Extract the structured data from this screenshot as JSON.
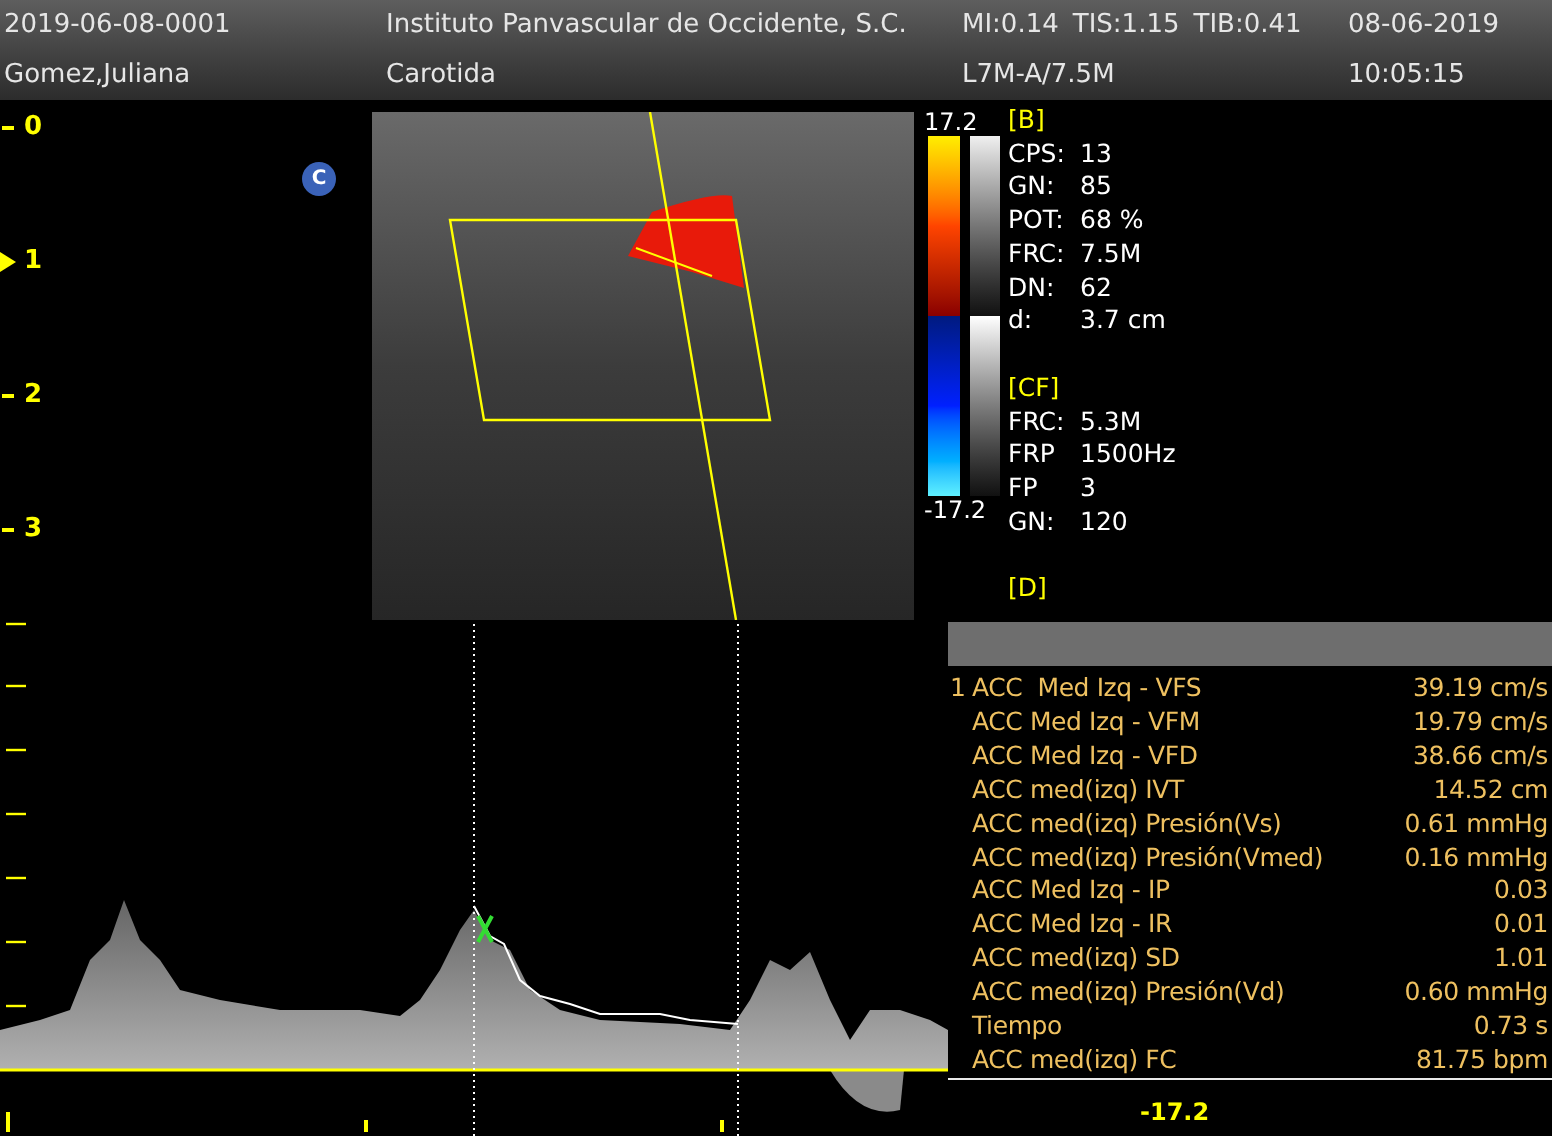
{
  "header": {
    "study_id": "2019-06-08-0001",
    "institution": "Instituto Panvascular de Occidente, S.C.",
    "indices": [
      "MI:0.14",
      "TIS:1.15",
      "TIB:0.41"
    ],
    "date": "08-06-2019",
    "patient": "Gomez,Juliana",
    "exam": "Carotida",
    "probe": "L7M-A/7.5M",
    "time": "10:05:15"
  },
  "depth_scale": [
    {
      "label": "0",
      "focus": false
    },
    {
      "label": "1",
      "focus": true
    },
    {
      "label": "2",
      "focus": false
    },
    {
      "label": "3",
      "focus": false
    }
  ],
  "mode_badge": "C",
  "color_scale": {
    "max": "17.2",
    "min": "-17.2"
  },
  "parameters": [
    {
      "heading": "[B]",
      "rows": [
        {
          "label": "CPS:",
          "value": "13"
        },
        {
          "label": "GN:",
          "value": "85"
        },
        {
          "label": "POT:",
          "value": "68 %"
        },
        {
          "label": "FRC:",
          "value": "7.5M"
        },
        {
          "label": "DN:",
          "value": "62"
        },
        {
          "label": "d:",
          "value": "3.7 cm"
        }
      ]
    },
    {
      "heading": "[CF]",
      "rows": [
        {
          "label": "FRC:",
          "value": "5.3M"
        },
        {
          "label": "FRP",
          "value": "1500Hz"
        },
        {
          "label": "FP",
          "value": "3"
        },
        {
          "label": "GN:",
          "value": "120"
        }
      ]
    },
    {
      "heading": "[D]"
    }
  ],
  "measurements": [
    {
      "index": "1",
      "label": "ACC  Med Izq - VFS",
      "value": "39.19 cm/s"
    },
    {
      "label": "ACC Med Izq - VFM",
      "value": "19.79 cm/s"
    },
    {
      "label": "ACC Med Izq - VFD",
      "value": "38.66 cm/s"
    },
    {
      "label": "ACC med(izq) IVT",
      "value": "14.52 cm"
    },
    {
      "label": "ACC med(izq) Presión(Vs)",
      "value": "0.61 mmHg"
    },
    {
      "label": "ACC med(izq) Presión(Vmed)",
      "value": "0.16 mmHg"
    },
    {
      "label": "ACC Med Izq - IP",
      "value": "0.03"
    },
    {
      "label": "ACC Med Izq - IR",
      "value": "0.01"
    },
    {
      "label": "ACC med(izq) SD",
      "value": "1.01"
    },
    {
      "label": "ACC med(izq) Presión(Vd)",
      "value": "0.60 mmHg"
    },
    {
      "label": "Tiempo",
      "value": "0.73 s"
    },
    {
      "label": "ACC med(izq) FC",
      "value": "81.75 bpm"
    }
  ],
  "spectrum_min": "-17.2"
}
